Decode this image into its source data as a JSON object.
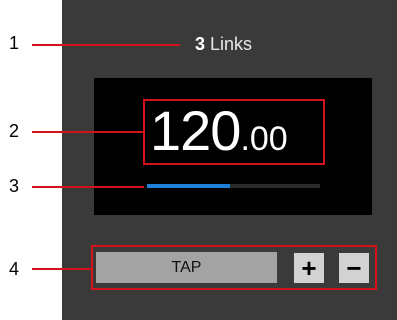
{
  "links": {
    "count": "3",
    "label": "Links"
  },
  "tempo": {
    "integer": "120",
    "decimal": ".00"
  },
  "phase_progress": 0.48,
  "controls": {
    "tap_label": "TAP",
    "plus_label": "+",
    "minus_label": "−"
  },
  "callouts": [
    "1",
    "2",
    "3",
    "4"
  ],
  "colors": {
    "panel": "#3a3a3a",
    "display": "#000000",
    "highlight": "#d4121c",
    "progress": "#1e7fd6",
    "tap_button": "#a3a3a3",
    "step_buttons": "#d2d2d2"
  }
}
